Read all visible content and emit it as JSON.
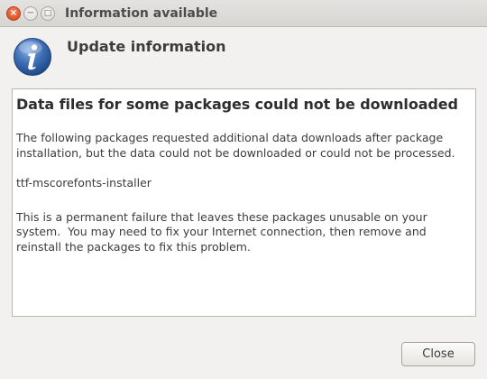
{
  "window": {
    "title": "Information available",
    "controls": {
      "close_glyph": "×",
      "minimize_glyph": "−",
      "maximize_glyph": "□"
    }
  },
  "dialog": {
    "icon": "information-icon",
    "heading": "Update information",
    "content": {
      "title": "Data files for some packages could not be downloaded",
      "paragraph_1": "The following packages requested additional data downloads after package installation, but the data could not be downloaded or could not be processed.",
      "package_name": "ttf-mscorefonts-installer",
      "paragraph_2": "This is a permanent failure that leaves these packages unusable on your system.  You may need to fix your Internet connection, then remove and reinstall the packages to fix this problem."
    },
    "close_button_label": "Close"
  },
  "colors": {
    "window_background": "#f2f1f0",
    "close_control": "#e25a2e",
    "info_icon_blue": "#3d6eb4"
  }
}
